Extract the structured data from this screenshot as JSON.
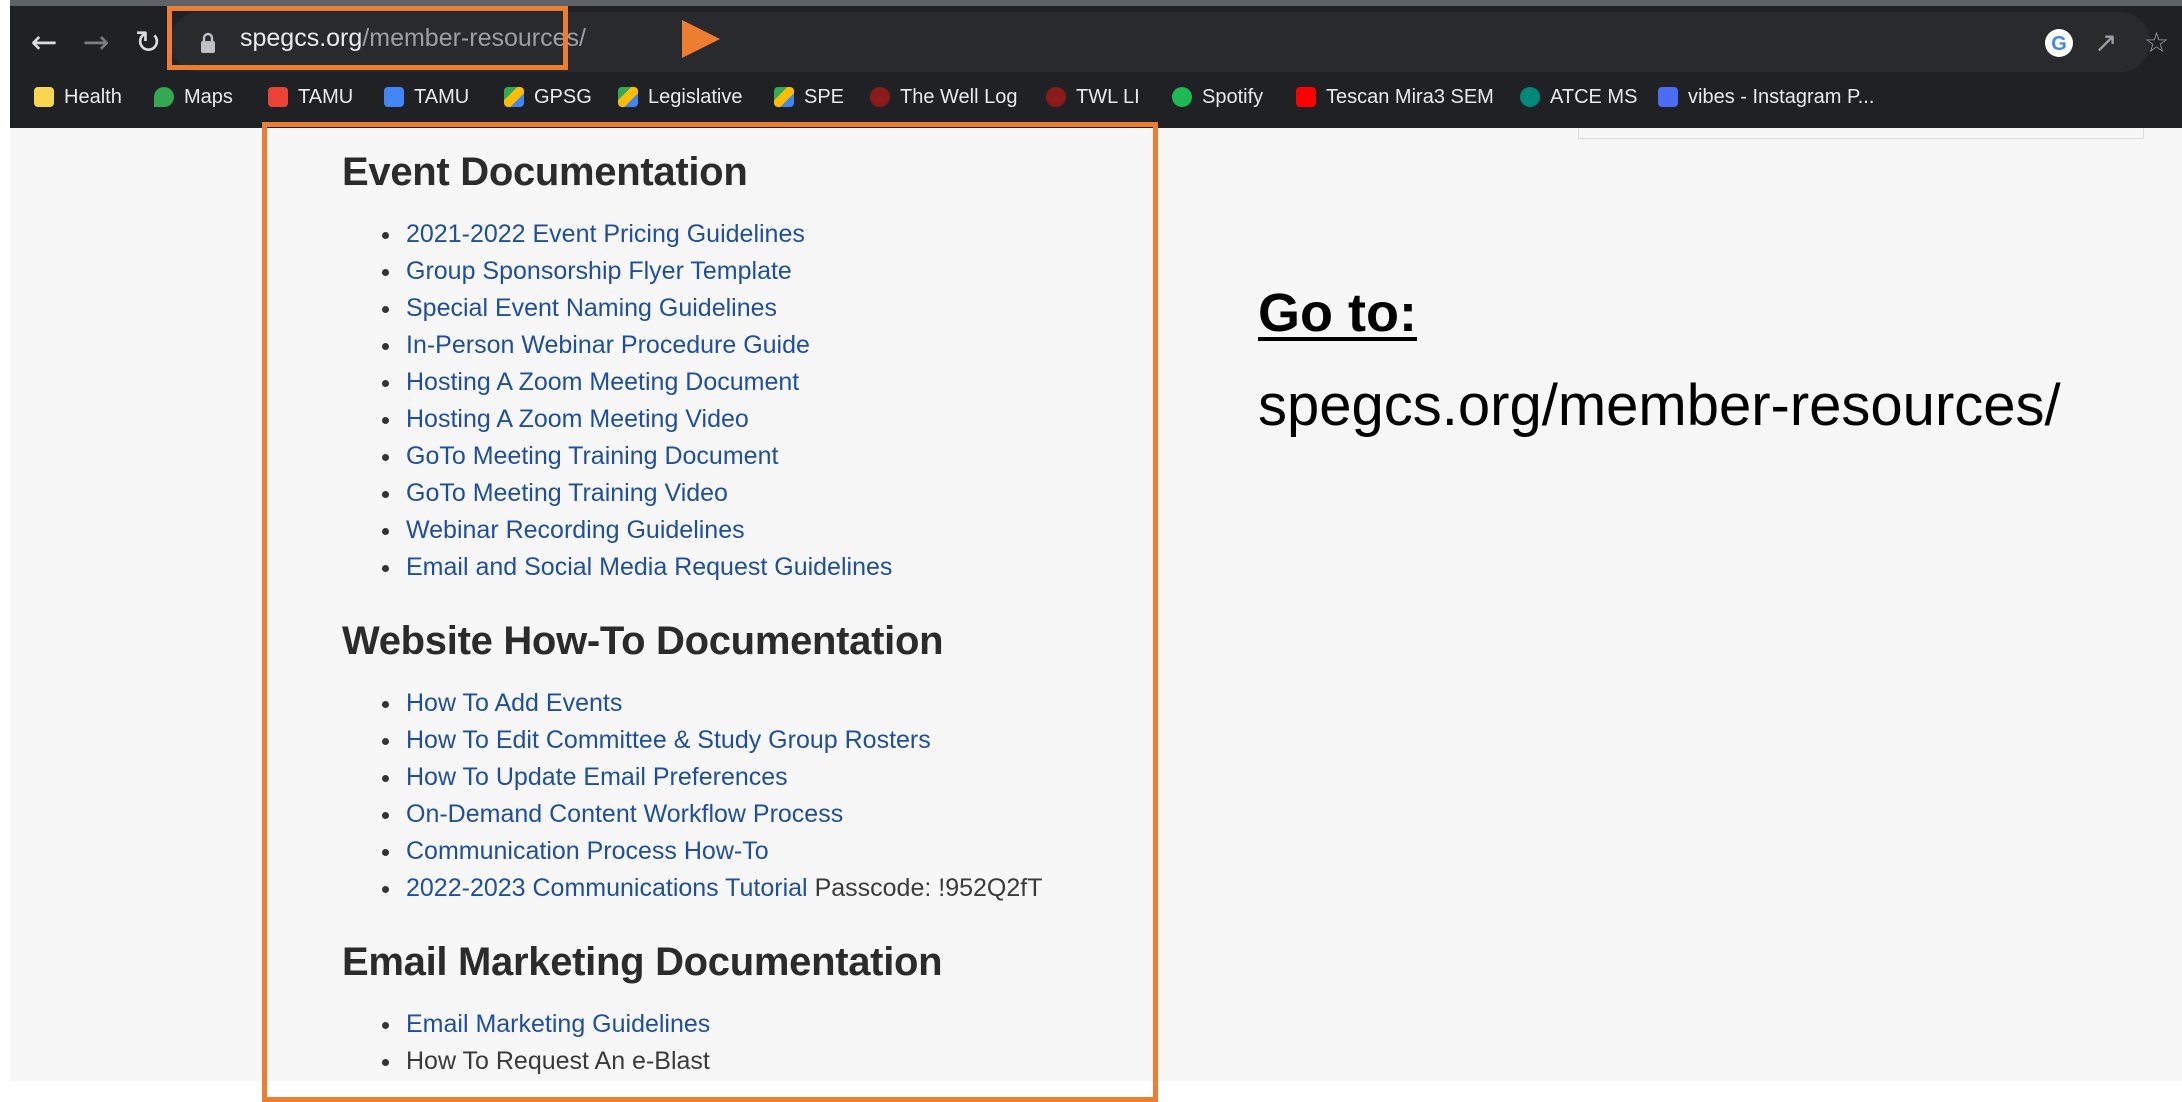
{
  "browser": {
    "url_domain": "spegcs.org",
    "url_path": "/member-resources/",
    "bookmarks": [
      {
        "label": "Health",
        "icon": "folder-icon",
        "color": "#f9d64f"
      },
      {
        "label": "Maps",
        "icon": "maps-icon",
        "color": "#34a853"
      },
      {
        "label": "TAMU",
        "icon": "gmail-icon",
        "color": "#ea4335"
      },
      {
        "label": "TAMU",
        "icon": "calendar-icon",
        "color": "#4285f4"
      },
      {
        "label": "GPSG",
        "icon": "drive-icon",
        "color": "#fbbc04"
      },
      {
        "label": "Legislative",
        "icon": "drive-icon",
        "color": "#fbbc04"
      },
      {
        "label": "SPE",
        "icon": "drive-icon",
        "color": "#fbbc04"
      },
      {
        "label": "The Well Log",
        "icon": "well-log-icon",
        "color": "#8b1a1a"
      },
      {
        "label": "TWL LI",
        "icon": "well-log-icon",
        "color": "#8b1a1a"
      },
      {
        "label": "Spotify",
        "icon": "spotify-icon",
        "color": "#1db954"
      },
      {
        "label": "Tescan Mira3 SEM",
        "icon": "youtube-icon",
        "color": "#ff0000"
      },
      {
        "label": "ATCE MS",
        "icon": "atce-icon",
        "color": "#00897b"
      },
      {
        "label": "vibes - Instagram P...",
        "icon": "heart-icon",
        "color": "#4a6cf7"
      }
    ]
  },
  "sections": [
    {
      "title": "Event Documentation",
      "links": [
        "2021-2022 Event Pricing Guidelines",
        "Group Sponsorship Flyer Template",
        "Special Event Naming Guidelines",
        "In-Person Webinar Procedure Guide",
        "Hosting A Zoom Meeting Document",
        "Hosting A Zoom Meeting Video",
        "GoTo Meeting Training Document",
        "GoTo Meeting Training Video",
        "Webinar Recording Guidelines",
        "Email and Social Media Request Guidelines"
      ]
    },
    {
      "title": "Website How-To Documentation",
      "links": [
        "How To Add Events",
        "How To Edit Committee & Study Group Rosters",
        "How To Update Email Preferences",
        "On-Demand Content Workflow Process",
        "Communication Process How-To",
        "2022-2023 Communications Tutorial"
      ],
      "passcode_text": " Passcode: !952Q2fT"
    },
    {
      "title": "Email Marketing Documentation",
      "links": [
        "Email Marketing Guidelines"
      ],
      "plain_items": [
        "How To Request An e-Blast"
      ]
    }
  ],
  "annotation": {
    "heading": "Go to:",
    "url": "spegcs.org/member-resources/",
    "highlight_color": "#ed7d31"
  }
}
